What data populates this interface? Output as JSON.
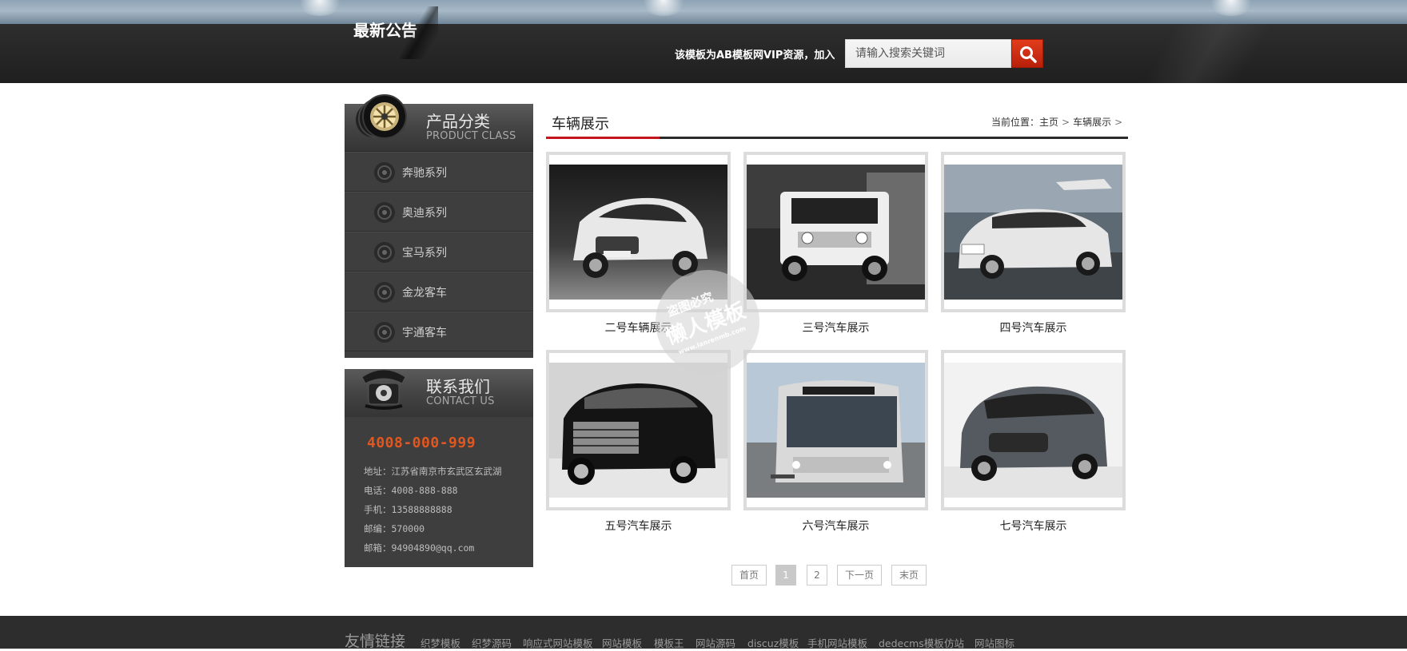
{
  "notice": {
    "title": "最新公告",
    "vip_text": "该模板为AB模板网VIP资源，加入"
  },
  "search": {
    "placeholder": "请输入搜索关键词",
    "button_icon": "search-icon"
  },
  "sidebar": {
    "category_title": "产品分类",
    "category_subtitle": "PRODUCT CLASS",
    "categories": [
      "奔驰系列",
      "奥迪系列",
      "宝马系列",
      "金龙客车",
      "宇通客车"
    ],
    "contact_title": "联系我们",
    "contact_subtitle": "CONTACT US",
    "hotline": "4008-000-999",
    "address": "地址：江苏省南京市玄武区玄武湖",
    "phone": "电话：4008-888-888",
    "mobile": "手机：13588888888",
    "postcode": "邮编：570000",
    "email": "邮箱：94904890@qq.com"
  },
  "main": {
    "section_title": "车辆展示",
    "breadcrumb_prefix": "当前位置：",
    "breadcrumb": [
      "主页",
      "车辆展示"
    ],
    "products": [
      {
        "name": "二号车辆展示"
      },
      {
        "name": "三号汽车展示"
      },
      {
        "name": "四号汽车展示"
      },
      {
        "name": "五号汽车展示"
      },
      {
        "name": "六号汽车展示"
      },
      {
        "name": "七号汽车展示"
      }
    ]
  },
  "pagination": {
    "first": "首页",
    "pages": [
      "1",
      "2"
    ],
    "current": "1",
    "next": "下一页",
    "last": "末页"
  },
  "watermark": {
    "line1": "盗图必究",
    "line2": "懒人模板",
    "line3": "www.lanrenmb.com"
  },
  "footer": {
    "title": "友情链接",
    "links": [
      "织梦模板",
      "织梦源码",
      "响应式网站模板",
      "网站模板",
      "模板王",
      "网站源码",
      "discuz模板",
      "手机网站模板",
      "dedecms模板",
      "仿站",
      "网站图标"
    ]
  },
  "colors": {
    "accent_red": "#c5161d",
    "hotline_orange": "#e2571f",
    "dark_bg": "#3e3e3e"
  }
}
